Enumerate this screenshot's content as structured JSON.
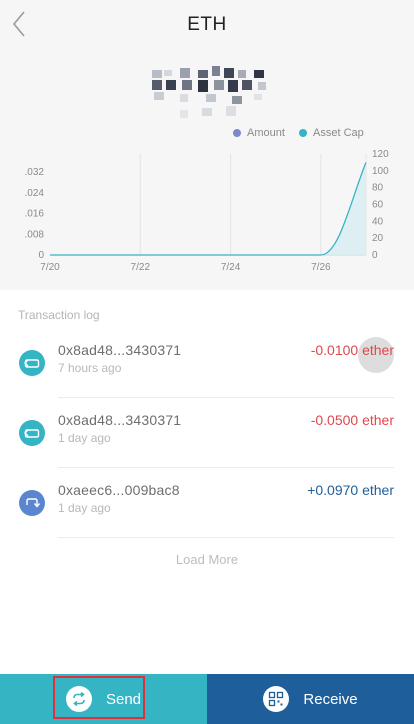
{
  "header": {
    "title": "ETH"
  },
  "legend": [
    {
      "label": "Amount",
      "color": "#7a8ac6"
    },
    {
      "label": "Asset Cap",
      "color": "#35b4c4"
    }
  ],
  "chart_data": {
    "type": "line",
    "x_ticks": [
      "7/20",
      "7/22",
      "7/24",
      "7/26"
    ],
    "left_axis_ticks": [
      "0",
      ".008",
      ".016",
      ".024",
      ".032"
    ],
    "right_axis_ticks": [
      "0",
      "20",
      "40",
      "60",
      "80",
      "100",
      "120"
    ],
    "series": [
      {
        "name": "Asset Cap",
        "x": [
          "7/20",
          "7/21",
          "7/22",
          "7/23",
          "7/24",
          "7/25",
          "7/26",
          "7/27"
        ],
        "values": [
          0,
          0,
          0,
          0,
          0,
          0,
          0,
          110
        ]
      }
    ],
    "ylim_right": [
      0,
      120
    ],
    "ylim_left": [
      0,
      0.032
    ]
  },
  "transactions": {
    "title": "Transaction log",
    "items": [
      {
        "address": "0x8ad48...3430371",
        "time": "7 hours ago",
        "amount": "-0.0100 ether",
        "direction": "out",
        "color": "#e0474c"
      },
      {
        "address": "0x8ad48...3430371",
        "time": "1 day ago",
        "amount": "-0.0500 ether",
        "direction": "out",
        "color": "#e0474c"
      },
      {
        "address": "0xaeec6...009bac8",
        "time": "1 day ago",
        "amount": "+0.0970 ether",
        "direction": "in",
        "color": "#1e5f9b"
      }
    ],
    "load_more": "Load More"
  },
  "actions": {
    "send_label": "Send",
    "receive_label": "Receive"
  },
  "colors": {
    "send_bg": "#35b4c4",
    "receive_bg": "#1e5f9b",
    "icon_out": "#35b4c4",
    "icon_in": "#5a86d0",
    "highlight": "#e0303a"
  }
}
